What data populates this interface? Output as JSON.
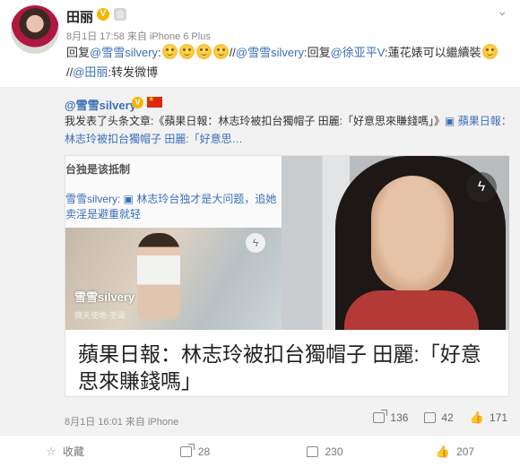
{
  "post": {
    "username": "田丽",
    "verified_badge": "V",
    "member_icon": "会",
    "time": "8月1日 17:58",
    "source": "来自 iPhone 6 Plus",
    "text_parts": [
      {
        "t": "回复",
        "link": false
      },
      {
        "t": "@雪雪silvery",
        "link": true
      },
      {
        "t": ":",
        "link": false
      },
      {
        "emoji": true
      },
      {
        "emoji": true
      },
      {
        "emoji": true
      },
      {
        "emoji": true
      },
      {
        "t": "//",
        "link": false
      },
      {
        "t": "@雪雪silvery",
        "link": true
      },
      {
        "t": ":回复",
        "link": false
      },
      {
        "t": "@徐亚平V",
        "link": true
      },
      {
        "t": ":蓮花婊可以繼續裝",
        "link": false
      },
      {
        "emoji": true
      },
      {
        "t": "//",
        "link": false
      },
      {
        "t": "@田丽",
        "link": true
      },
      {
        "t": ":转发微博",
        "link": false
      }
    ]
  },
  "repost": {
    "username": "@雪雪silvery",
    "verified_badge": "V",
    "text_parts": [
      {
        "t": "我发表了头条文章:《蘋果日報：林志玲被扣台獨帽子 田麗:「好意思來賺錢嗎」》",
        "link": false
      },
      {
        "t": "▣ 蘋果日報：林志玲被扣台獨帽子 田麗:「好意思…",
        "link": true
      }
    ],
    "card": {
      "thumb_header": "台独是该抵制",
      "thumb_quote": "雪雪silvery: ▣ 林志玲台独才是大问题，追她卖淫是避重就轻",
      "thumb_caption": "雪雪silvery",
      "thumb_credit": "微天使地-圣诞",
      "title": "蘋果日報：林志玲被扣台獨帽子 田麗:「好意思來賺錢嗎」"
    },
    "time": "8月1日 16:01",
    "source": "来自 iPhone",
    "share_count": "136",
    "comment_count": "42",
    "like_count": "171"
  },
  "actions": {
    "favorite": "收藏",
    "share": "28",
    "comment": "230",
    "like": "207"
  },
  "icons": {
    "chevron": "chevron-down-icon",
    "flash": "lightning-icon",
    "share": "share-icon",
    "comment": "comment-icon",
    "like": "thumbs-up-icon",
    "favorite": "star-icon"
  },
  "colors": {
    "link": "#3a6fb8",
    "vip": "#f7b500",
    "repost_bg": "#f2f2f2"
  }
}
